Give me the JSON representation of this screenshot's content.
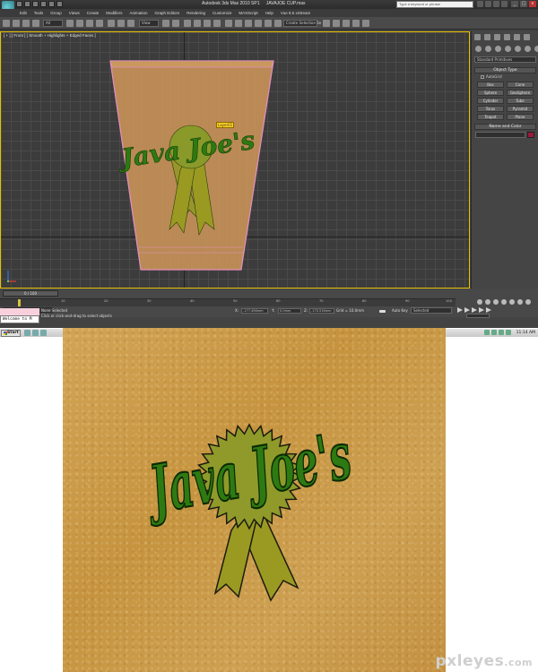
{
  "app": {
    "title_parts": [
      "Autodesk 3ds Max 2010 SP1",
      "JAVAJOE CUP.max"
    ],
    "search_placeholder": "Type a keyword or phrase",
    "win_min": "_",
    "win_max": "□",
    "win_close": "x"
  },
  "menu": [
    "Edit",
    "Tools",
    "Group",
    "Views",
    "Create",
    "Modifiers",
    "Animation",
    "Graph Editors",
    "Rendering",
    "Customize",
    "MAXScript",
    "Help",
    "Vue 8.5 xStream"
  ],
  "toolbar": {
    "filter_all": "All",
    "view_dropdown": "View",
    "selection_set": "Create Selection Se"
  },
  "viewport": {
    "label": "[ + ] [ Front ] [ Smooth + Highlights + Edged Faces ]",
    "layer_tag": "Layer01"
  },
  "command_panel": {
    "category": "Standard Primitives",
    "object_type_title": "Object Type",
    "autogrid": "AutoGrid",
    "buttons": [
      "Box",
      "Cone",
      "Sphere",
      "GeoSphere",
      "Cylinder",
      "Tube",
      "Torus",
      "Pyramid",
      "Teapot",
      "Plane"
    ],
    "name_color_title": "Name and Color"
  },
  "timeline": {
    "slider": "0 / 100",
    "marks": [
      "0",
      "10",
      "20",
      "30",
      "40",
      "50",
      "60",
      "70",
      "80",
      "90",
      "100"
    ]
  },
  "status": {
    "selection": "None Selected",
    "prompt": "Click or click-and-drag to select objects",
    "x_label": "X:",
    "y_label": "Y:",
    "z_label": "Z:",
    "x_value": "-177.456mm",
    "y_value": "0.0mm",
    "z_value": "-170.516mm",
    "grid": "Grid = 10.0mm",
    "auto_key": "Auto Key",
    "selected": "Selected"
  },
  "listener": "Welcome to M",
  "taskbar": {
    "start": "Start",
    "clock": "11:14 AM"
  },
  "texture": {
    "logo_text": "Java Joe's"
  },
  "watermark": {
    "name": "pxleyes",
    "domain": ".com"
  },
  "colors": {
    "texture": "#c99a4c",
    "ribbon": "#9a9a22",
    "logo_text": "#2e7a12",
    "viewport_frame": "#e6c000",
    "cup_wire": "#e58fc0"
  }
}
